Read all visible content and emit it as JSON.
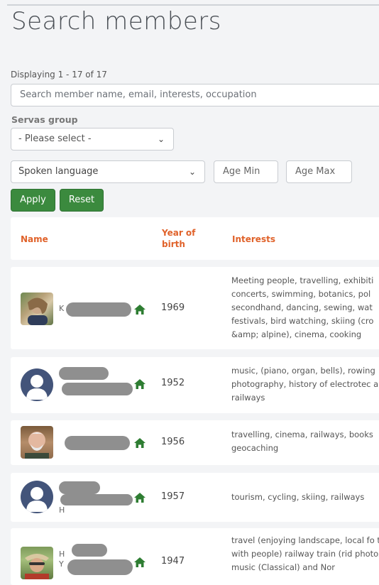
{
  "page": {
    "title": "Search members"
  },
  "results": {
    "displaying": "Displaying 1 - 17 of 17"
  },
  "search": {
    "placeholder": "Search member name, email, interests, occupation"
  },
  "filters": {
    "servas_group_label": "Servas group",
    "servas_group_value": "- Please select -",
    "spoken_language_value": "Spoken language",
    "age_min_placeholder": "Age Min",
    "age_max_placeholder": "Age Max",
    "apply_label": "Apply",
    "reset_label": "Reset"
  },
  "table": {
    "headers": {
      "name": "Name",
      "year_of_birth": "Year of birth",
      "interests": "Interests"
    },
    "rows": [
      {
        "name_visible": "K",
        "year": "1969",
        "avatar": "photo",
        "interests": "Meeting people, travelling, exhibiti concerts, swimming, botanics, pol secondhand, dancing, sewing, wat festivals, bird watching, skiing (cro &amp; alpine), cinema, cooking"
      },
      {
        "name_visible": "",
        "year": "1952",
        "avatar": "silhouette",
        "interests": "music, (piano, organ, bells), rowing photography, history of electrotec and railways"
      },
      {
        "name_visible": "",
        "year": "1956",
        "avatar": "photo",
        "interests": "travelling, cinema, railways, books geocaching"
      },
      {
        "name_visible": "H",
        "year": "1957",
        "avatar": "silhouette",
        "interests": "tourism, cycling, skiing, railways"
      },
      {
        "name_visible": "H Y",
        "year": "1947",
        "avatar": "photo",
        "interests": "travel (enjoying landscape, local fo talks with people) railway train (rid photos), music (Classical) and Nor"
      }
    ]
  },
  "icons": {
    "home": "home-icon",
    "chevron": "chevron-down-icon"
  },
  "colors": {
    "primary": "#3b8a3e",
    "header_text": "#e0622a",
    "avatar_placeholder": "#43547a"
  }
}
